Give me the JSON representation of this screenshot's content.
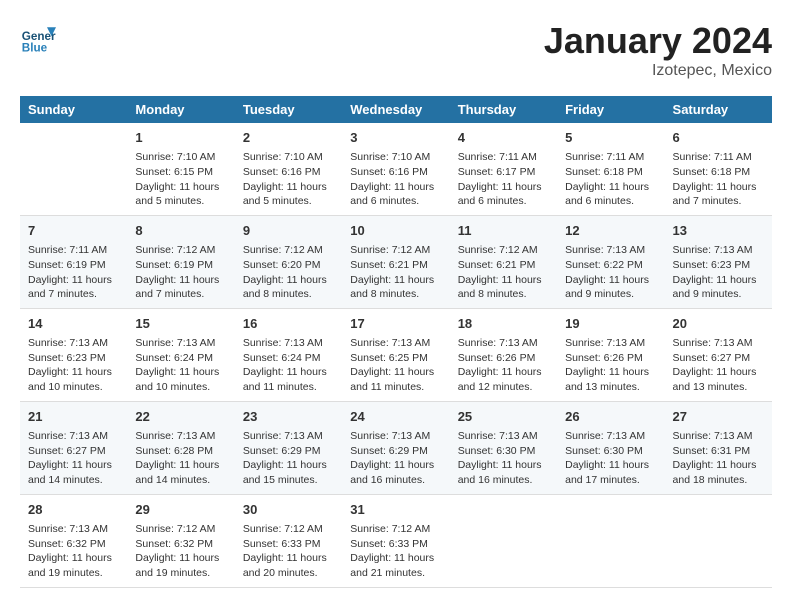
{
  "header": {
    "logo_line1": "General",
    "logo_line2": "Blue",
    "title": "January 2024",
    "subtitle": "Izotepec, Mexico"
  },
  "columns": [
    "Sunday",
    "Monday",
    "Tuesday",
    "Wednesday",
    "Thursday",
    "Friday",
    "Saturday"
  ],
  "rows": [
    [
      {
        "day": "",
        "info": ""
      },
      {
        "day": "1",
        "info": "Sunrise: 7:10 AM\nSunset: 6:15 PM\nDaylight: 11 hours\nand 5 minutes."
      },
      {
        "day": "2",
        "info": "Sunrise: 7:10 AM\nSunset: 6:16 PM\nDaylight: 11 hours\nand 5 minutes."
      },
      {
        "day": "3",
        "info": "Sunrise: 7:10 AM\nSunset: 6:16 PM\nDaylight: 11 hours\nand 6 minutes."
      },
      {
        "day": "4",
        "info": "Sunrise: 7:11 AM\nSunset: 6:17 PM\nDaylight: 11 hours\nand 6 minutes."
      },
      {
        "day": "5",
        "info": "Sunrise: 7:11 AM\nSunset: 6:18 PM\nDaylight: 11 hours\nand 6 minutes."
      },
      {
        "day": "6",
        "info": "Sunrise: 7:11 AM\nSunset: 6:18 PM\nDaylight: 11 hours\nand 7 minutes."
      }
    ],
    [
      {
        "day": "7",
        "info": "Sunrise: 7:11 AM\nSunset: 6:19 PM\nDaylight: 11 hours\nand 7 minutes."
      },
      {
        "day": "8",
        "info": "Sunrise: 7:12 AM\nSunset: 6:19 PM\nDaylight: 11 hours\nand 7 minutes."
      },
      {
        "day": "9",
        "info": "Sunrise: 7:12 AM\nSunset: 6:20 PM\nDaylight: 11 hours\nand 8 minutes."
      },
      {
        "day": "10",
        "info": "Sunrise: 7:12 AM\nSunset: 6:21 PM\nDaylight: 11 hours\nand 8 minutes."
      },
      {
        "day": "11",
        "info": "Sunrise: 7:12 AM\nSunset: 6:21 PM\nDaylight: 11 hours\nand 8 minutes."
      },
      {
        "day": "12",
        "info": "Sunrise: 7:13 AM\nSunset: 6:22 PM\nDaylight: 11 hours\nand 9 minutes."
      },
      {
        "day": "13",
        "info": "Sunrise: 7:13 AM\nSunset: 6:23 PM\nDaylight: 11 hours\nand 9 minutes."
      }
    ],
    [
      {
        "day": "14",
        "info": "Sunrise: 7:13 AM\nSunset: 6:23 PM\nDaylight: 11 hours\nand 10 minutes."
      },
      {
        "day": "15",
        "info": "Sunrise: 7:13 AM\nSunset: 6:24 PM\nDaylight: 11 hours\nand 10 minutes."
      },
      {
        "day": "16",
        "info": "Sunrise: 7:13 AM\nSunset: 6:24 PM\nDaylight: 11 hours\nand 11 minutes."
      },
      {
        "day": "17",
        "info": "Sunrise: 7:13 AM\nSunset: 6:25 PM\nDaylight: 11 hours\nand 11 minutes."
      },
      {
        "day": "18",
        "info": "Sunrise: 7:13 AM\nSunset: 6:26 PM\nDaylight: 11 hours\nand 12 minutes."
      },
      {
        "day": "19",
        "info": "Sunrise: 7:13 AM\nSunset: 6:26 PM\nDaylight: 11 hours\nand 13 minutes."
      },
      {
        "day": "20",
        "info": "Sunrise: 7:13 AM\nSunset: 6:27 PM\nDaylight: 11 hours\nand 13 minutes."
      }
    ],
    [
      {
        "day": "21",
        "info": "Sunrise: 7:13 AM\nSunset: 6:27 PM\nDaylight: 11 hours\nand 14 minutes."
      },
      {
        "day": "22",
        "info": "Sunrise: 7:13 AM\nSunset: 6:28 PM\nDaylight: 11 hours\nand 14 minutes."
      },
      {
        "day": "23",
        "info": "Sunrise: 7:13 AM\nSunset: 6:29 PM\nDaylight: 11 hours\nand 15 minutes."
      },
      {
        "day": "24",
        "info": "Sunrise: 7:13 AM\nSunset: 6:29 PM\nDaylight: 11 hours\nand 16 minutes."
      },
      {
        "day": "25",
        "info": "Sunrise: 7:13 AM\nSunset: 6:30 PM\nDaylight: 11 hours\nand 16 minutes."
      },
      {
        "day": "26",
        "info": "Sunrise: 7:13 AM\nSunset: 6:30 PM\nDaylight: 11 hours\nand 17 minutes."
      },
      {
        "day": "27",
        "info": "Sunrise: 7:13 AM\nSunset: 6:31 PM\nDaylight: 11 hours\nand 18 minutes."
      }
    ],
    [
      {
        "day": "28",
        "info": "Sunrise: 7:13 AM\nSunset: 6:32 PM\nDaylight: 11 hours\nand 19 minutes."
      },
      {
        "day": "29",
        "info": "Sunrise: 7:12 AM\nSunset: 6:32 PM\nDaylight: 11 hours\nand 19 minutes."
      },
      {
        "day": "30",
        "info": "Sunrise: 7:12 AM\nSunset: 6:33 PM\nDaylight: 11 hours\nand 20 minutes."
      },
      {
        "day": "31",
        "info": "Sunrise: 7:12 AM\nSunset: 6:33 PM\nDaylight: 11 hours\nand 21 minutes."
      },
      {
        "day": "",
        "info": ""
      },
      {
        "day": "",
        "info": ""
      },
      {
        "day": "",
        "info": ""
      }
    ]
  ]
}
